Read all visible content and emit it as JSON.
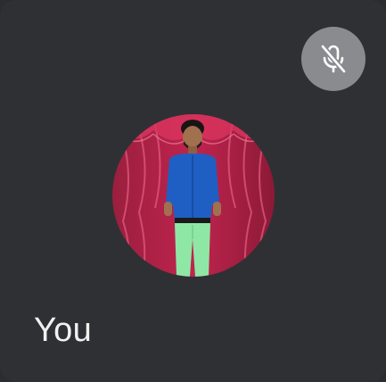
{
  "participant": {
    "name": "You",
    "mic_icon": "mic-off-icon",
    "avatar_icon": "participant-photo"
  },
  "colors": {
    "tile_background": "#2f3034",
    "mute_button": "#8a8b8f",
    "name_text": "#f1f1f1"
  }
}
